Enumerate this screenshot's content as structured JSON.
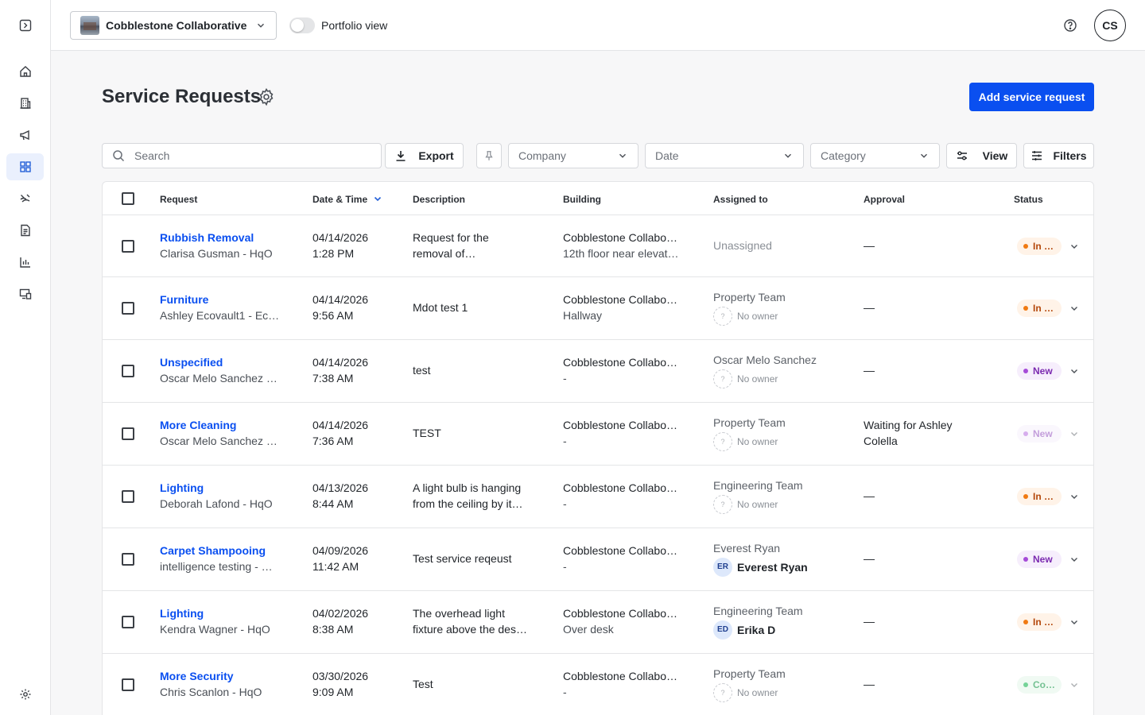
{
  "topbar": {
    "company": "Cobblestone Collaborative",
    "portfolio_label": "Portfolio view",
    "user_initials": "CS"
  },
  "header": {
    "title": "Service Requests",
    "add_button": "Add service request"
  },
  "toolbar": {
    "search_placeholder": "Search",
    "export": "Export",
    "company": "Company",
    "date": "Date",
    "category": "Category",
    "view": "View",
    "filters": "Filters"
  },
  "table": {
    "columns": [
      "Request",
      "Date & Time",
      "Description",
      "Building",
      "Assigned to",
      "Approval",
      "Status"
    ],
    "rows": [
      {
        "title": "Rubbish Removal",
        "requester": "Clarisa Gusman - HqO",
        "date": "04/14/2026",
        "time": "1:28 PM",
        "desc1": "Request for the",
        "desc2": "removal of…",
        "bldg": "Cobblestone Collabo…",
        "loc": "12th floor near elevat…",
        "assigned": "Unassigned",
        "owner": "",
        "owner_initials": "",
        "approval1": "—",
        "approval2": "",
        "status": "In …"
      },
      {
        "title": "Furniture",
        "requester": "Ashley Ecovault1 - Ec…",
        "date": "04/14/2026",
        "time": "9:56 AM",
        "desc1": "Mdot test 1",
        "desc2": "",
        "bldg": "Cobblestone Collabo…",
        "loc": "Hallway",
        "assigned": "Property Team",
        "owner": "No owner",
        "owner_initials": "?",
        "approval1": "—",
        "approval2": "",
        "status": "In …"
      },
      {
        "title": "Unspecified",
        "requester": "Oscar Melo Sanchez …",
        "date": "04/14/2026",
        "time": "7:38 AM",
        "desc1": "test",
        "desc2": "",
        "bldg": "Cobblestone Collabo…",
        "loc": "-",
        "assigned": "Oscar Melo Sanchez",
        "owner": "No owner",
        "owner_initials": "?",
        "approval1": "—",
        "approval2": "",
        "status": "New"
      },
      {
        "title": "More Cleaning",
        "requester": "Oscar Melo Sanchez …",
        "date": "04/14/2026",
        "time": "7:36 AM",
        "desc1": "TEST",
        "desc2": "",
        "bldg": "Cobblestone Collabo…",
        "loc": "-",
        "assigned": "Property Team",
        "owner": "No owner",
        "owner_initials": "?",
        "approval1": "Waiting for Ashley",
        "approval2": "Colella",
        "status": "New"
      },
      {
        "title": "Lighting",
        "requester": "Deborah Lafond - HqO",
        "date": "04/13/2026",
        "time": "8:44 AM",
        "desc1": "A light bulb is hanging",
        "desc2": "from the ceiling by it…",
        "bldg": "Cobblestone Collabo…",
        "loc": "-",
        "assigned": "Engineering Team",
        "owner": "No owner",
        "owner_initials": "?",
        "approval1": "—",
        "approval2": "",
        "status": "In …"
      },
      {
        "title": "Carpet Shampooing",
        "requester": "intelligence testing - …",
        "date": "04/09/2026",
        "time": "11:42 AM",
        "desc1": "Test service reqeust",
        "desc2": "",
        "bldg": "Cobblestone Collabo…",
        "loc": "-",
        "assigned": "Everest Ryan",
        "owner": "Everest Ryan",
        "owner_initials": "ER",
        "approval1": "—",
        "approval2": "",
        "status": "New"
      },
      {
        "title": "Lighting",
        "requester": "Kendra Wagner - HqO",
        "date": "04/02/2026",
        "time": "8:38 AM",
        "desc1": "The overhead light",
        "desc2": "fixture above the des…",
        "bldg": "Cobblestone Collabo…",
        "loc": "Over desk",
        "assigned": "Engineering Team",
        "owner": "Erika D",
        "owner_initials": "ED",
        "approval1": "—",
        "approval2": "",
        "status": "In …"
      },
      {
        "title": "More Security",
        "requester": "Chris Scanlon - HqO",
        "date": "03/30/2026",
        "time": "9:09 AM",
        "desc1": "Test",
        "desc2": "",
        "bldg": "Cobblestone Collabo…",
        "loc": "-",
        "assigned": "Property Team",
        "owner": "No owner",
        "owner_initials": "?",
        "approval1": "—",
        "approval2": "",
        "status": "Co…"
      }
    ]
  },
  "colors": {
    "primary": "#0a4ff0",
    "in_progress": "#f07a12",
    "new": "#a64bd8",
    "complete": "#3bc16c"
  }
}
